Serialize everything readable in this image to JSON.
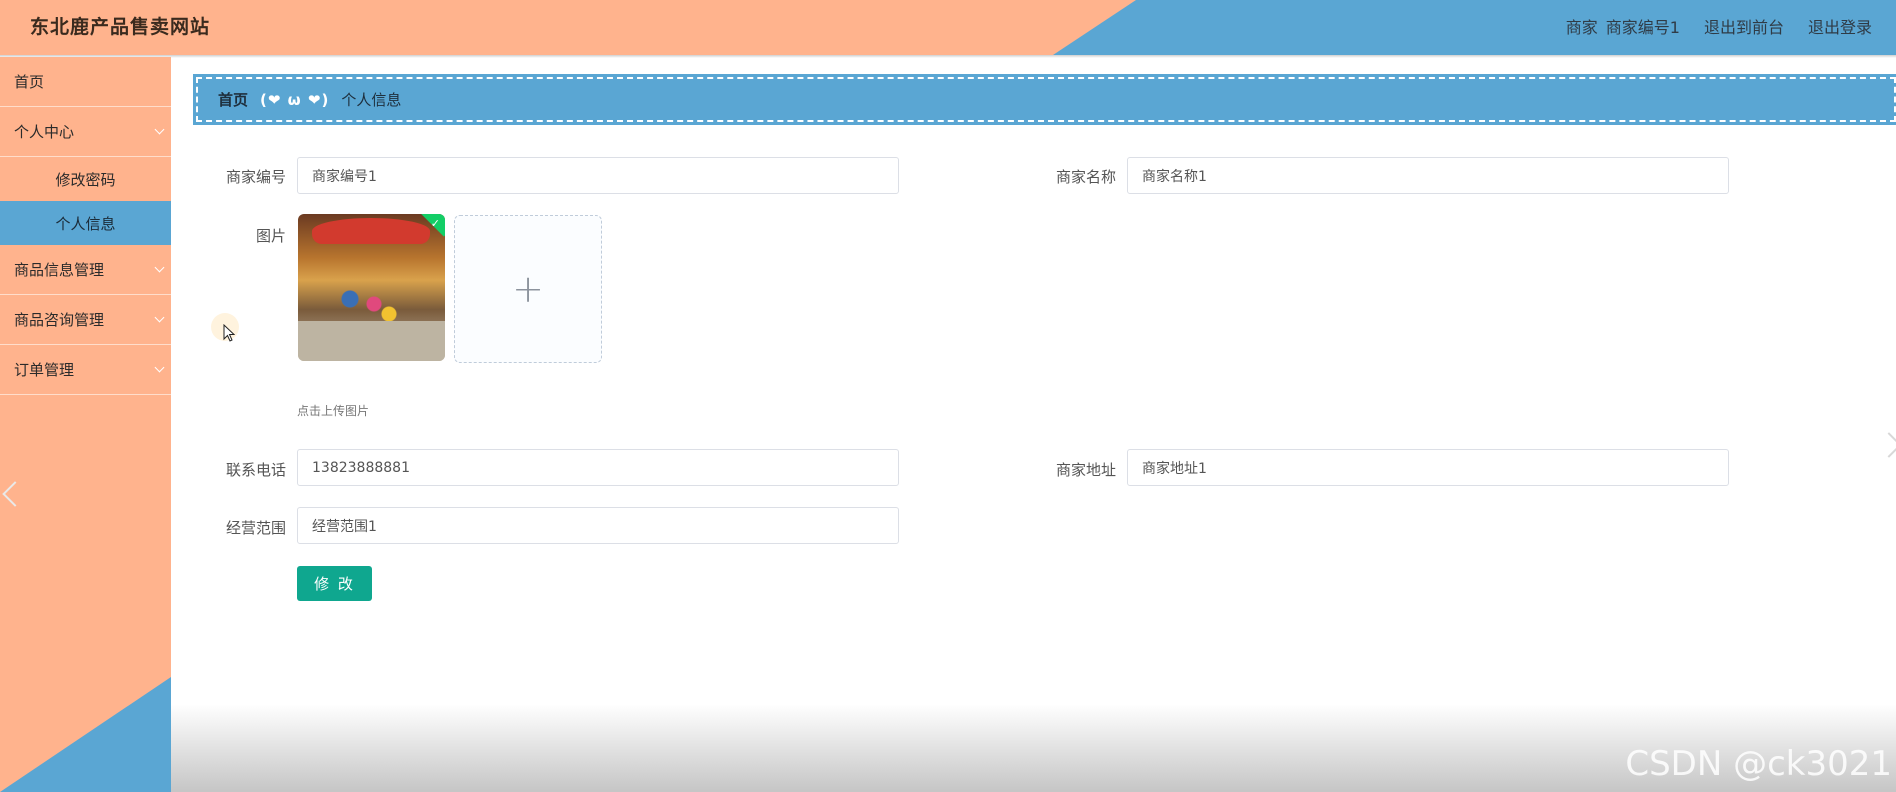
{
  "header": {
    "title": "东北鹿产品售卖网站",
    "role": "商家",
    "username": "商家编号1",
    "to_front": "退出到前台",
    "logout": "退出登录"
  },
  "sidebar": {
    "items": [
      {
        "label": "首页"
      },
      {
        "label": "个人中心",
        "children": [
          "修改密码",
          "个人信息"
        ]
      },
      {
        "label": "商品信息管理"
      },
      {
        "label": "商品咨询管理"
      },
      {
        "label": "订单管理"
      }
    ],
    "active": "个人信息"
  },
  "breadcrumb": {
    "home": "首页",
    "separator": "(❤ ω ❤)",
    "current": "个人信息"
  },
  "form": {
    "merchant_no_label": "商家编号",
    "merchant_no_value": "商家编号1",
    "merchant_name_label": "商家名称",
    "merchant_name_value": "商家名称1",
    "image_label": "图片",
    "upload_tip": "点击上传图片",
    "phone_label": "联系电话",
    "phone_value": "13823888881",
    "address_label": "商家地址",
    "address_value": "商家地址1",
    "scope_label": "经营范围",
    "scope_value": "经营范围1",
    "submit_label": "修 改"
  },
  "watermark": "CSDN @ck3021",
  "colors": {
    "orange": "#ffb38d",
    "blue": "#5aa6d3",
    "button": "#0fa78f"
  }
}
